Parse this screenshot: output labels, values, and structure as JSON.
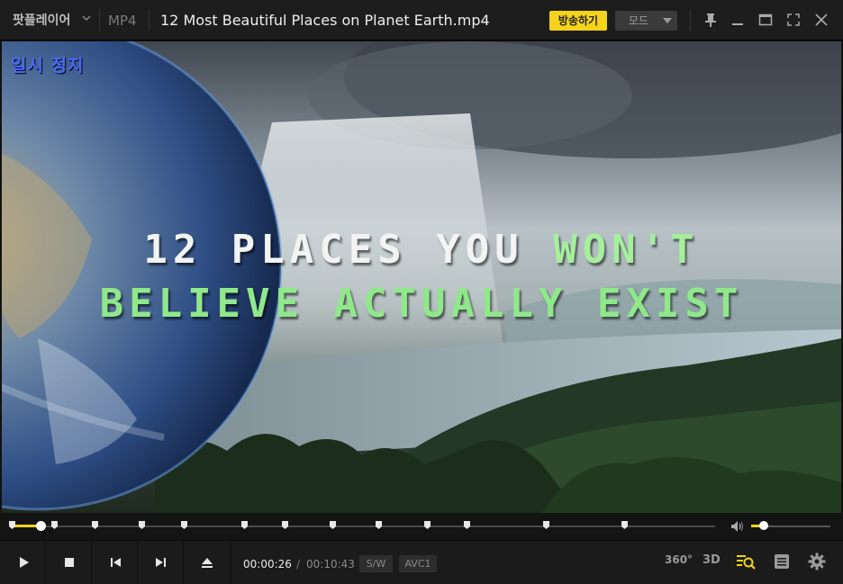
{
  "titlebar": {
    "app_name": "팟플레이어",
    "format": "MP4",
    "file_title": "12 Most Beautiful Places on Planet Earth.mp4",
    "broadcast_label": "방송하기",
    "mode_label": "모드"
  },
  "video": {
    "status_label": "일시 정지",
    "headline_line1_white": "12 PLACES YOU ",
    "headline_line1_green": "WON'T",
    "headline_line2": "BELIEVE ACTUALLY EXIST"
  },
  "seek": {
    "progress_fraction": 0.042,
    "volume_fraction": 0.16
  },
  "controls": {
    "current_time": "00:00:26",
    "separator": "/",
    "total_time": "00:10:43",
    "decoder_tag": "S/W",
    "codec_tag": "AVC1",
    "label_360": "360°",
    "label_3d": "3D"
  },
  "colors": {
    "accent": "#f4d31a",
    "status_blue": "#4a6aff",
    "headline_green": "#8fe88a"
  }
}
